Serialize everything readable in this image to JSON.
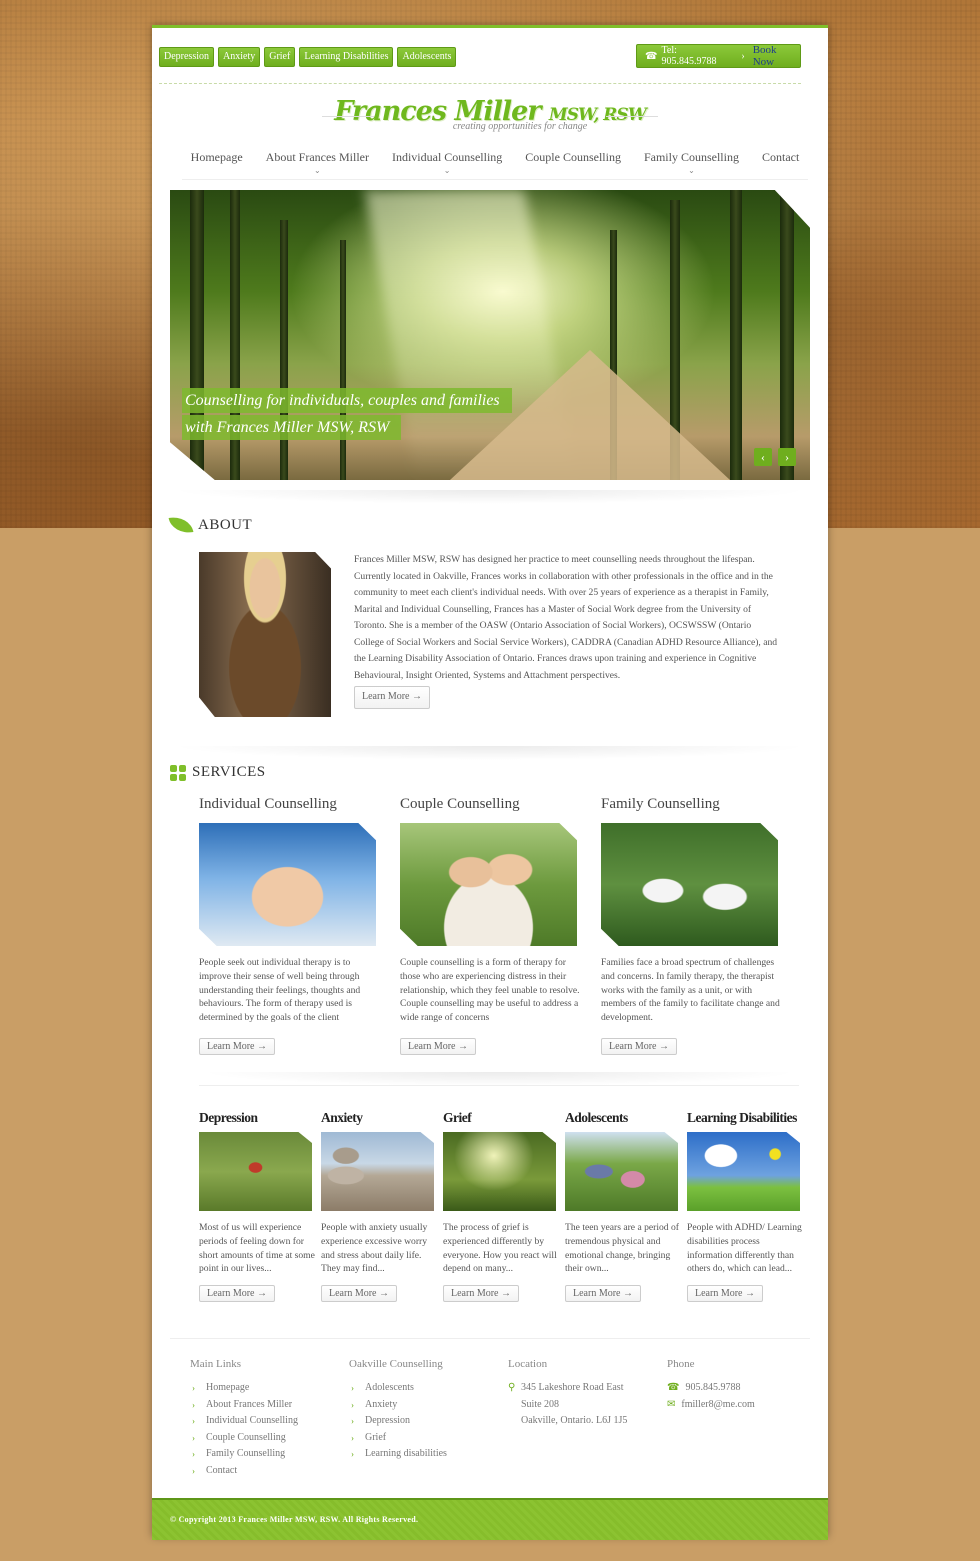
{
  "colors": {
    "accent": "#7fbf2a",
    "accent_dark": "#6fae1e",
    "link_blue": "#1f3e8a",
    "background": "#c99e66"
  },
  "top_tags": [
    "Depression",
    "Anxiety",
    "Grief",
    "Learning Disabilities",
    "Adolescents"
  ],
  "phone_box": {
    "icon": "phone-icon",
    "phone_text": "Tel: 905.845.9788",
    "book_label": "Book Now"
  },
  "logo": {
    "name": "Frances Miller",
    "credentials": "MSW, RSW",
    "tagline": "creating opportunities for change"
  },
  "nav": [
    {
      "label": "Homepage",
      "has_dropdown": false
    },
    {
      "label": "About Frances Miller",
      "has_dropdown": true
    },
    {
      "label": "Individual Counselling",
      "has_dropdown": true
    },
    {
      "label": "Couple Counselling",
      "has_dropdown": false
    },
    {
      "label": "Family Counselling",
      "has_dropdown": true
    },
    {
      "label": "Contact",
      "has_dropdown": false
    }
  ],
  "hero": {
    "caption_line1": "Counselling for individuals, couples and families",
    "caption_line2": "with Frances Miller MSW, RSW",
    "prev": "‹",
    "next": "›"
  },
  "about": {
    "heading": "ABOUT",
    "text": "Frances Miller MSW, RSW has designed her practice to meet counselling needs throughout the lifespan. Currently located in Oakville, Frances works in collaboration with other professionals in the office and in the community to meet each client's individual needs. With over 25 years of experience as a therapist in Family, Marital and Individual Counselling, Frances has a Master of Social Work degree from the University of Toronto. She is a member of the OASW (Ontario Association of Social Workers), OCSWSSW (Ontario College of Social Workers and Social Service Workers), CADDRA (Canadian ADHD Resource Alliance), and the Learning Disability Association of Ontario.  Frances draws upon training and experience in Cognitive Behavioural, Insight Oriented, Systems and Attachment perspectives.",
    "button": "Learn More →"
  },
  "services": {
    "heading": "SERVICES",
    "items": [
      {
        "title": "Individual Counselling",
        "text": "People seek out individual therapy is to improve their sense of well being through understanding their feelings, thoughts and behaviours. The form of therapy used is determined by the goals of the client",
        "button": "Learn More →"
      },
      {
        "title": "Couple Counselling",
        "text": "Couple counselling is a form of therapy for those who are experiencing distress in their relationship, which they feel unable to resolve. Couple counselling may be useful to address a wide range of concerns",
        "button": "Learn More →"
      },
      {
        "title": "Family Counselling",
        "text": "Families face a broad spectrum of challenges and concerns. In family therapy, the therapist works with the family as a unit, or with members of the family to facilitate change and development.",
        "button": "Learn More →"
      }
    ]
  },
  "topics": [
    {
      "title": "Depression",
      "text": "Most of us will experience periods of feeling down for short amounts of time at some point in our lives...",
      "button": "Learn More →"
    },
    {
      "title": "Anxiety",
      "text": "People with anxiety usually experience excessive worry and stress about daily life. They may find...",
      "button": "Learn More →"
    },
    {
      "title": "Grief",
      "text": "The process of grief is experienced differently by everyone. How you react will depend on many...",
      "button": "Learn More →"
    },
    {
      "title": "Adolescents",
      "text": "The teen years are a period of tremendous physical and emotional change, bringing their own...",
      "button": "Learn More →"
    },
    {
      "title": "Learning Disabilities",
      "text": "People with ADHD/ Learning disabilities process information differently than others do, which can lead...",
      "button": "Learn More →"
    }
  ],
  "footer": {
    "main_links": {
      "heading": "Main Links",
      "items": [
        "Homepage",
        "About Frances Miller",
        "Individual Counselling",
        "Couple Counselling",
        "Family Counselling",
        "Contact"
      ]
    },
    "oakville": {
      "heading": "Oakville Counselling",
      "items": [
        "Adolescents",
        "Anxiety",
        "Depression",
        "Grief",
        "Learning disabilities"
      ]
    },
    "location": {
      "heading": "Location",
      "line1": "345 Lakeshore Road East",
      "line2": "Suite 208",
      "line3": "Oakville, Ontario. L6J 1J5"
    },
    "phone": {
      "heading": "Phone",
      "phone": "905.845.9788",
      "email": "fmiller8@me.com"
    }
  },
  "copyright": "© Copyright 2013 Frances Miller MSW, RSW. All Rights Reserved."
}
